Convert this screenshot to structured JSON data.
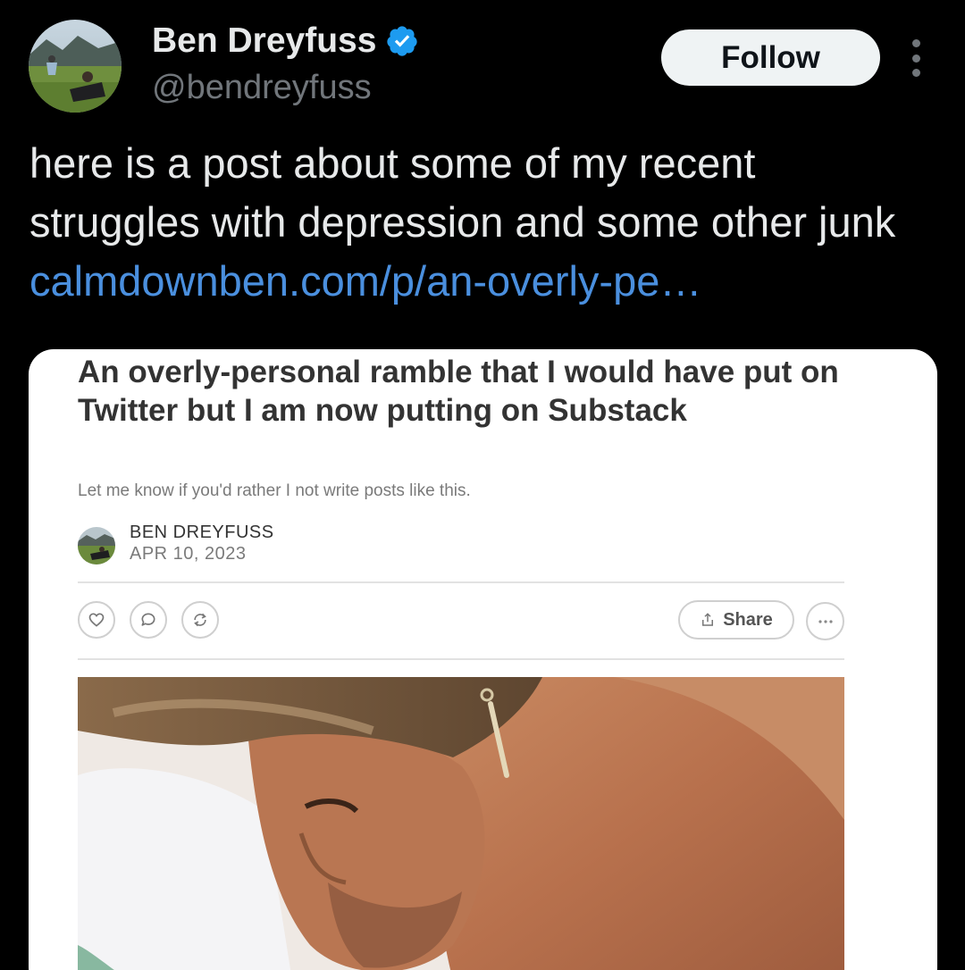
{
  "author": {
    "display_name": "Ben Dreyfuss",
    "handle": "@bendreyfuss",
    "avatar_icon": "profile-photo-icon",
    "verified_icon": "verified-badge-icon"
  },
  "actions": {
    "follow_label": "Follow",
    "more_icon": "more-vertical-icon"
  },
  "tweet": {
    "text": "here is a post about some of my recent struggles with depression and some other junk ",
    "link_text": "calmdownben.com/p/an-overly-pe…"
  },
  "card": {
    "title": "An overly-personal ramble that I would have put on Twitter but I am now putting on Substack",
    "subtitle": "Let me know if you'd rather I not write posts like this.",
    "author_name": "BEN DREYFUSS",
    "date": "APR 10, 2023",
    "buttons": {
      "like_icon": "heart-icon",
      "comment_icon": "comment-icon",
      "restack_icon": "restack-icon",
      "share_label": "Share",
      "share_icon": "share-icon",
      "more_icon": "more-horizontal-icon"
    }
  },
  "colors": {
    "background": "#000000",
    "link": "#4a8fde",
    "verified": "#1d9bf0",
    "handle": "#71767b"
  }
}
